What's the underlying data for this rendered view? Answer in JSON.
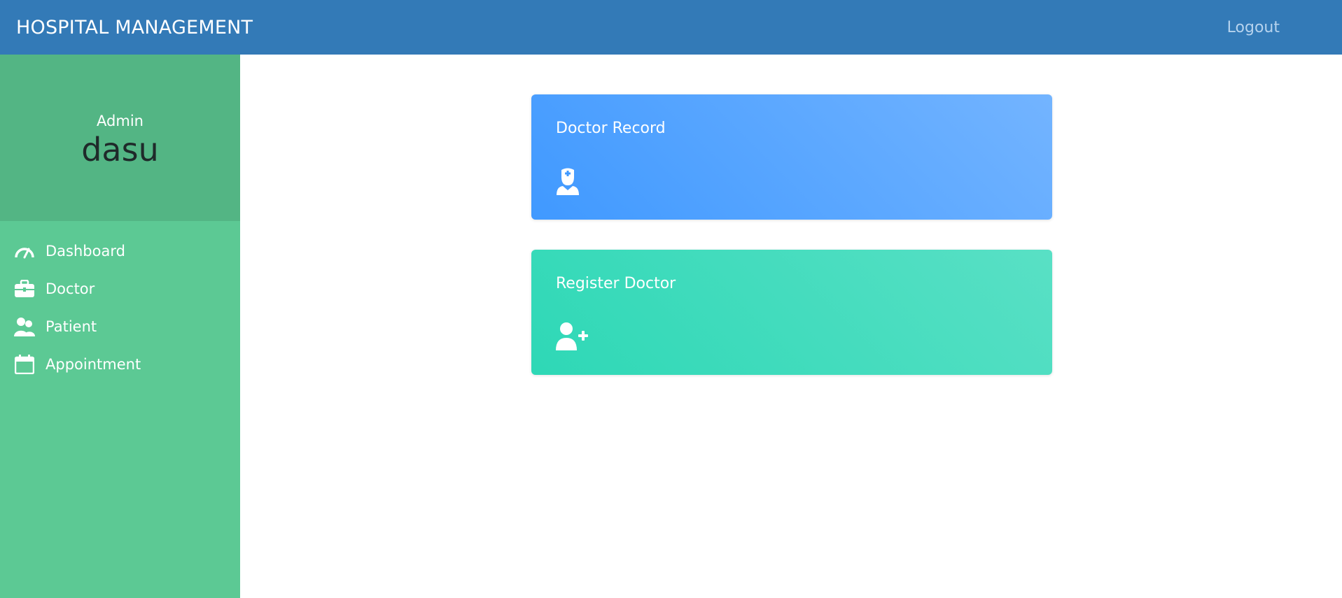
{
  "header": {
    "brand": "HOSPITAL MANAGEMENT",
    "logout_label": "Logout"
  },
  "sidebar": {
    "role": "Admin",
    "username": "dasu",
    "items": [
      {
        "label": "Dashboard",
        "icon": "dashboard-gauge-icon"
      },
      {
        "label": "Doctor",
        "icon": "briefcase-icon"
      },
      {
        "label": "Patient",
        "icon": "users-icon"
      },
      {
        "label": "Appointment",
        "icon": "calendar-icon"
      }
    ]
  },
  "cards": [
    {
      "title": "Doctor Record",
      "icon": "doctor-icon",
      "color": "#4099ff"
    },
    {
      "title": "Register Doctor",
      "icon": "user-plus-icon",
      "color": "#2ed8b6"
    }
  ],
  "colors": {
    "header_bg": "#337ab7",
    "sidebar_bg": "#5cc994",
    "profile_bg": "#53b584"
  }
}
